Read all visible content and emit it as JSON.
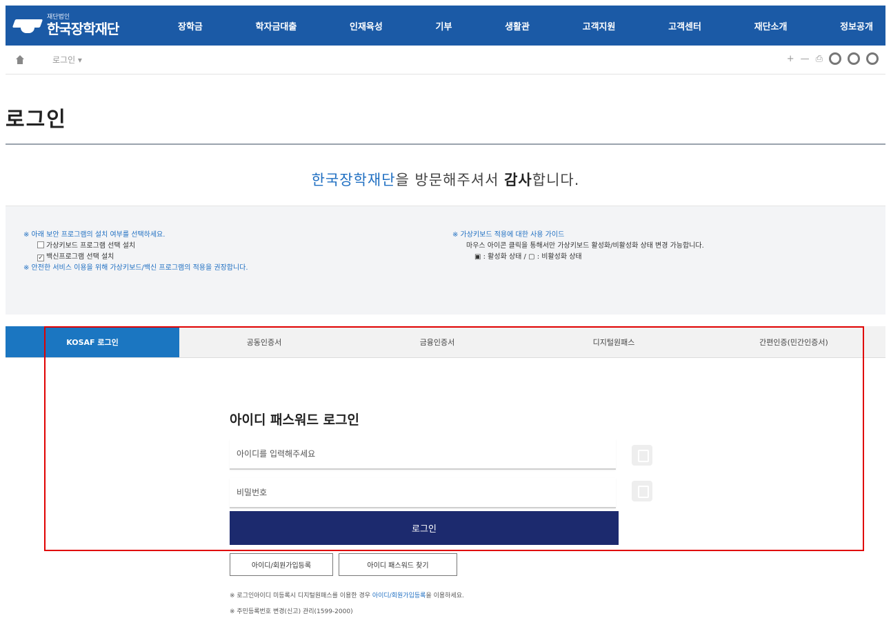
{
  "header": {
    "logo_small": "재단법인",
    "logo_main": "한국장학재단",
    "menu": [
      "장학금",
      "학자금대출",
      "인재육성",
      "기부",
      "생활관",
      "고객지원",
      "고객센터",
      "재단소개",
      "정보공개"
    ]
  },
  "breadcrumb": {
    "current": "로그인 ▾"
  },
  "toolbar": {
    "zoom_in": "+",
    "zoom_out": "—",
    "print": "⎙"
  },
  "page": {
    "title": "로그인",
    "welcome_brand": "한국장학재단",
    "welcome_mid": "을 방문해주셔서 ",
    "welcome_strong": "감사",
    "welcome_end": "합니다."
  },
  "notice": {
    "left_heading": "※ 아래 보안 프로그램의 설치 여부를 선택하세요.",
    "left_opt1": "가상키보드 프로그램 선택 설치",
    "left_opt2": "백신프로그램 선택 설치",
    "left_footer": "※ 안전한 서비스 이용을 위해 가상키보드/백신 프로그램의 적용을 권장합니다.",
    "right_heading": "※ 가상키보드 적용에 대한 사용 가이드",
    "right_line1": "마우스 아이콘 클릭을 통해서만 가상키보드 활성화/비활성화 상태 변경 가능합니다.",
    "right_line2": "▣ : 활성화 상태 / ▢ : 비활성화 상태"
  },
  "tabs": [
    "KOSAF 로그인",
    "공동인증서",
    "금융인증서",
    "디지털원패스",
    "간편인증(민간인증서)"
  ],
  "login": {
    "title": "아이디 패스워드 로그인",
    "id_placeholder": "아이디를 입력해주세요",
    "pw_placeholder": "비밀번호",
    "submit": "로그인",
    "signup": "아이디/회원가입등록",
    "find": "아이디 패스워드 찾기",
    "help1_prefix": "※ 로그인아이디 미등록시 디지털원패스를 이용한 경우 ",
    "help1_link": "아이디/회원가입등록",
    "help1_suffix": "을 이용하세요.",
    "help2": "※ 주민등록번호 변경(신고) 관리(1599-2000)"
  }
}
